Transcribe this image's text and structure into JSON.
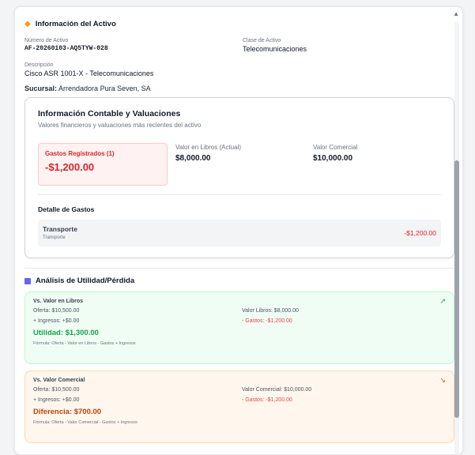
{
  "asset_info": {
    "title": "Información del Activo",
    "numero_label": "Número de Activo",
    "numero_value": "AF-20260103-AQ5TYW-028",
    "clase_label": "Clase de Activo",
    "clase_value": "Telecomunicaciones",
    "descripcion_label": "Descripción",
    "descripcion_value": "Cisco ASR 1001-X - Telecomunicaciones",
    "sucursal_label": "Sucursal:",
    "sucursal_value": "Arrendadora Pura Seven, SA"
  },
  "accounting": {
    "title": "Información Contable y Valuaciones",
    "subtitle": "Valores financieros y valuaciones más recientes del activo",
    "gastos_label": "Gastos Registrados (1)",
    "gastos_value": "-$1,200.00",
    "libros_label": "Valor en Libros (Actual)",
    "libros_value": "$8,000.00",
    "comercial_label": "Valor Comercial",
    "comercial_value": "$10,000.00",
    "detalle_title": "Detalle de Gastos",
    "expense": {
      "name": "Transporte",
      "category": "Transporte",
      "amount": "-$1,200.00"
    }
  },
  "analysis": {
    "title": "Análisis de Utilidad/Pérdida",
    "libros": {
      "title": "Vs. Valor en Libros",
      "oferta": "Oferta: $10,500.00",
      "ingresos": "+ Ingresos: +$0.00",
      "ref_value": "Valor Libros: $8,000.00",
      "gastos": "- Gastos: -$1,200.00",
      "result": "Utilidad: $1,300.00",
      "formula": "Fórmula: Oferta - Valor en Libros - Gastos + Ingresos"
    },
    "comercial": {
      "title": "Vs. Valor Comercial",
      "oferta": "Oferta: $10,500.00",
      "ingresos": "+ Ingresos: +$0.00",
      "ref_value": "Valor Comercial: $10,000.00",
      "gastos": "- Gastos: -$1,200.00",
      "result": "Diferencia: $700.00",
      "formula": "Fórmula: Oferta - Valor Comercial - Gastos + Ingresos"
    }
  },
  "colors": {
    "red": "#dc2626",
    "green": "#16a34a",
    "orange": "#c2410c"
  }
}
